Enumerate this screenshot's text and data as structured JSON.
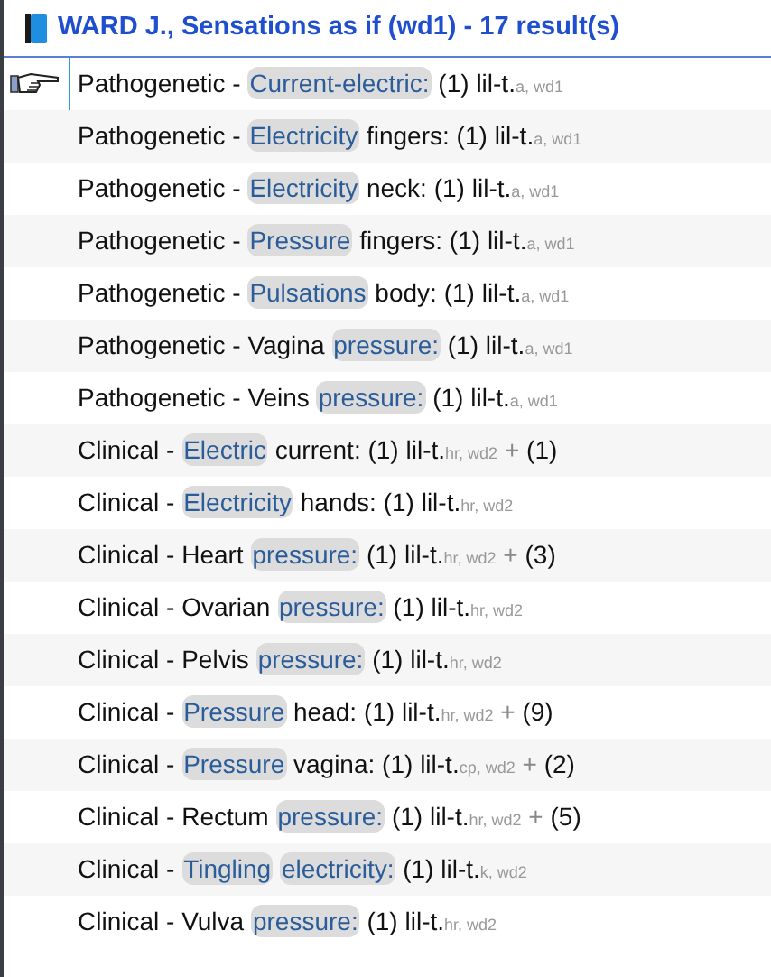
{
  "header": {
    "title": "WARD J., Sensations as if (wd1) - 17 result(s)"
  },
  "results": [
    {
      "selected": true,
      "prefix": "Pathogenetic -",
      "words": [
        {
          "text": "Current-electric:",
          "highlighted": true
        }
      ],
      "count": "(1)",
      "remedy": "lil-t.",
      "sources": "a, wd1"
    },
    {
      "selected": false,
      "prefix": "Pathogenetic -",
      "words": [
        {
          "text": "Electricity",
          "highlighted": true
        },
        {
          "text": "fingers:",
          "highlighted": false
        }
      ],
      "count": "(1)",
      "remedy": "lil-t.",
      "sources": "a, wd1"
    },
    {
      "selected": false,
      "prefix": "Pathogenetic -",
      "words": [
        {
          "text": "Electricity",
          "highlighted": true
        },
        {
          "text": "neck:",
          "highlighted": false
        }
      ],
      "count": "(1)",
      "remedy": "lil-t.",
      "sources": "a, wd1"
    },
    {
      "selected": false,
      "prefix": "Pathogenetic -",
      "words": [
        {
          "text": "Pressure",
          "highlighted": true
        },
        {
          "text": "fingers:",
          "highlighted": false
        }
      ],
      "count": "(1)",
      "remedy": "lil-t.",
      "sources": "a, wd1"
    },
    {
      "selected": false,
      "prefix": "Pathogenetic -",
      "words": [
        {
          "text": "Pulsations",
          "highlighted": true
        },
        {
          "text": "body:",
          "highlighted": false
        }
      ],
      "count": "(1)",
      "remedy": "lil-t.",
      "sources": "a, wd1"
    },
    {
      "selected": false,
      "prefix": "Pathogenetic -",
      "words": [
        {
          "text": "Vagina",
          "highlighted": false
        },
        {
          "text": "pressure:",
          "highlighted": true
        }
      ],
      "count": "(1)",
      "remedy": "lil-t.",
      "sources": "a, wd1"
    },
    {
      "selected": false,
      "prefix": "Pathogenetic -",
      "words": [
        {
          "text": "Veins",
          "highlighted": false
        },
        {
          "text": "pressure:",
          "highlighted": true
        }
      ],
      "count": "(1)",
      "remedy": "lil-t.",
      "sources": "a, wd1"
    },
    {
      "selected": false,
      "prefix": "Clinical -",
      "words": [
        {
          "text": "Electric",
          "highlighted": true
        },
        {
          "text": "current:",
          "highlighted": false
        }
      ],
      "count": "(1)",
      "remedy": "lil-t.",
      "sources": "hr, wd2",
      "plus": "+",
      "more": "(1)"
    },
    {
      "selected": false,
      "prefix": "Clinical -",
      "words": [
        {
          "text": "Electricity",
          "highlighted": true
        },
        {
          "text": "hands:",
          "highlighted": false
        }
      ],
      "count": "(1)",
      "remedy": "lil-t.",
      "sources": "hr, wd2"
    },
    {
      "selected": false,
      "prefix": "Clinical -",
      "words": [
        {
          "text": "Heart",
          "highlighted": false
        },
        {
          "text": "pressure:",
          "highlighted": true
        }
      ],
      "count": "(1)",
      "remedy": "lil-t.",
      "sources": "hr, wd2",
      "plus": "+",
      "more": "(3)"
    },
    {
      "selected": false,
      "prefix": "Clinical -",
      "words": [
        {
          "text": "Ovarian",
          "highlighted": false
        },
        {
          "text": "pressure:",
          "highlighted": true
        }
      ],
      "count": "(1)",
      "remedy": "lil-t.",
      "sources": "hr, wd2"
    },
    {
      "selected": false,
      "prefix": "Clinical -",
      "words": [
        {
          "text": "Pelvis",
          "highlighted": false
        },
        {
          "text": "pressure:",
          "highlighted": true
        }
      ],
      "count": "(1)",
      "remedy": "lil-t.",
      "sources": "hr, wd2"
    },
    {
      "selected": false,
      "prefix": "Clinical -",
      "words": [
        {
          "text": "Pressure",
          "highlighted": true
        },
        {
          "text": "head:",
          "highlighted": false
        }
      ],
      "count": "(1)",
      "remedy": "lil-t.",
      "sources": "hr, wd2",
      "plus": "+",
      "more": "(9)"
    },
    {
      "selected": false,
      "prefix": "Clinical -",
      "words": [
        {
          "text": "Pressure",
          "highlighted": true
        },
        {
          "text": "vagina:",
          "highlighted": false
        }
      ],
      "count": "(1)",
      "remedy": "lil-t.",
      "sources": "cp, wd2",
      "plus": "+",
      "more": "(2)"
    },
    {
      "selected": false,
      "prefix": "Clinical -",
      "words": [
        {
          "text": "Rectum",
          "highlighted": false
        },
        {
          "text": "pressure:",
          "highlighted": true
        }
      ],
      "count": "(1)",
      "remedy": "lil-t.",
      "sources": "hr, wd2",
      "plus": "+",
      "more": "(5)"
    },
    {
      "selected": false,
      "prefix": "Clinical -",
      "words": [
        {
          "text": "Tingling",
          "highlighted": true
        },
        {
          "text": "electricity:",
          "highlighted": true
        }
      ],
      "count": "(1)",
      "remedy": "lil-t.",
      "sources": "k, wd2"
    },
    {
      "selected": false,
      "prefix": "Clinical -",
      "words": [
        {
          "text": "Vulva",
          "highlighted": false
        },
        {
          "text": "pressure:",
          "highlighted": true
        }
      ],
      "count": "(1)",
      "remedy": "lil-t.",
      "sources": "hr, wd2"
    }
  ]
}
